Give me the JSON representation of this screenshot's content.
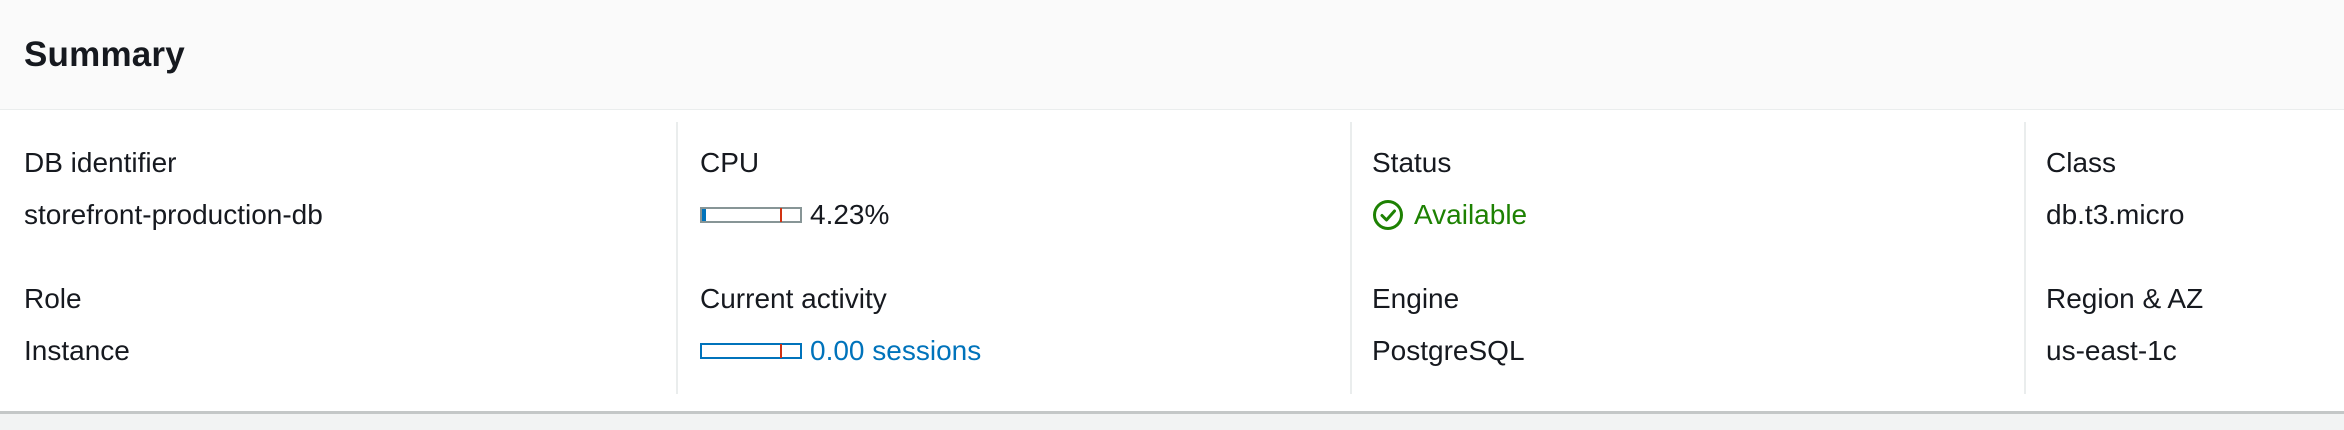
{
  "summary": {
    "title": "Summary",
    "db_identifier": {
      "label": "DB identifier",
      "value": "storefront-production-db"
    },
    "role": {
      "label": "Role",
      "value": "Instance"
    },
    "cpu": {
      "label": "CPU",
      "value": "4.23%",
      "meter_fraction": 0.0423,
      "threshold_fraction": 0.8
    },
    "current_activity": {
      "label": "Current activity",
      "value": "0.00 sessions",
      "meter_fraction": 0.0,
      "threshold_fraction": 0.8
    },
    "status": {
      "label": "Status",
      "value": "Available",
      "icon": "check-circle-icon",
      "color": "#1d8102"
    },
    "engine": {
      "label": "Engine",
      "value": "PostgreSQL"
    },
    "class": {
      "label": "Class",
      "value": "db.t3.micro"
    },
    "region_az": {
      "label": "Region & AZ",
      "value": "us-east-1c"
    }
  }
}
